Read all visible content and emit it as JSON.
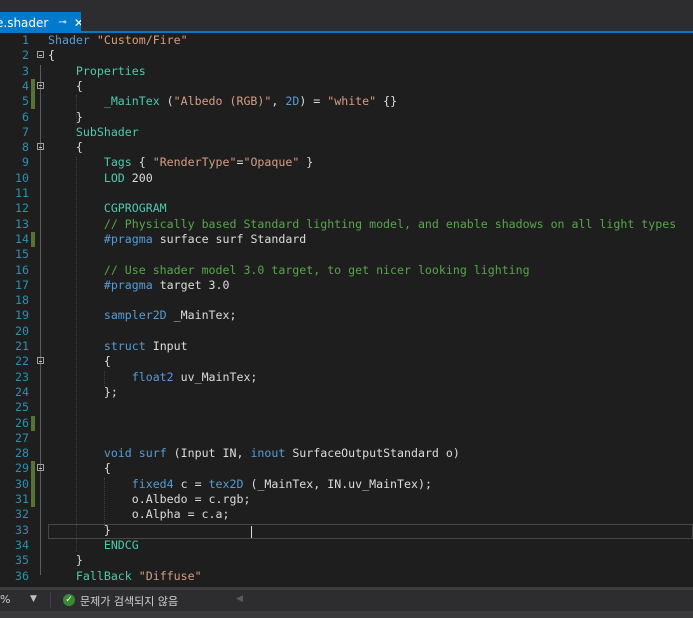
{
  "tab": {
    "title": "e.shader",
    "pin_icon": "pin-icon",
    "close_icon": "close-icon"
  },
  "editor": {
    "lines": [
      {
        "n": "1",
        "tokens": [
          [
            "kw",
            "Shader"
          ],
          [
            "tx",
            " "
          ],
          [
            "st",
            "\"Custom/Fire\""
          ]
        ]
      },
      {
        "n": "2",
        "tokens": [
          [
            "tx",
            "{"
          ]
        ]
      },
      {
        "n": "3",
        "tokens": [
          [
            "tx",
            "    "
          ],
          [
            "pr",
            "Properties"
          ]
        ]
      },
      {
        "n": "4",
        "tokens": [
          [
            "tx",
            "    {"
          ]
        ]
      },
      {
        "n": "5",
        "tokens": [
          [
            "tx",
            "        "
          ],
          [
            "pr",
            "_MainTex"
          ],
          [
            "tx",
            " ("
          ],
          [
            "st",
            "\"Albedo (RGB)\""
          ],
          [
            "tx",
            ", "
          ],
          [
            "kw",
            "2D"
          ],
          [
            "tx",
            ") = "
          ],
          [
            "st",
            "\"white\""
          ],
          [
            "tx",
            " {}"
          ]
        ]
      },
      {
        "n": "6",
        "tokens": [
          [
            "tx",
            "    }"
          ]
        ]
      },
      {
        "n": "7",
        "tokens": [
          [
            "tx",
            "    "
          ],
          [
            "pr",
            "SubShader"
          ]
        ]
      },
      {
        "n": "8",
        "tokens": [
          [
            "tx",
            "    {"
          ]
        ]
      },
      {
        "n": "9",
        "tokens": [
          [
            "tx",
            "        "
          ],
          [
            "pr",
            "Tags"
          ],
          [
            "tx",
            " { "
          ],
          [
            "st",
            "\"RenderType\""
          ],
          [
            "tx",
            "="
          ],
          [
            "st",
            "\"Opaque\""
          ],
          [
            "tx",
            " }"
          ]
        ]
      },
      {
        "n": "10",
        "tokens": [
          [
            "tx",
            "        "
          ],
          [
            "pr",
            "LOD"
          ],
          [
            "tx",
            " 200"
          ]
        ]
      },
      {
        "n": "11",
        "tokens": []
      },
      {
        "n": "12",
        "tokens": [
          [
            "tx",
            "        "
          ],
          [
            "pr",
            "CGPROGRAM"
          ]
        ]
      },
      {
        "n": "13",
        "tokens": [
          [
            "tx",
            "        "
          ],
          [
            "cm",
            "// Physically based Standard lighting model, and enable shadows on all light types"
          ]
        ]
      },
      {
        "n": "14",
        "tokens": [
          [
            "tx",
            "        "
          ],
          [
            "kw",
            "#pragma"
          ],
          [
            "tx",
            " surface surf Standard"
          ]
        ]
      },
      {
        "n": "15",
        "tokens": []
      },
      {
        "n": "16",
        "tokens": [
          [
            "tx",
            "        "
          ],
          [
            "cm",
            "// Use shader model 3.0 target, to get nicer looking lighting"
          ]
        ]
      },
      {
        "n": "17",
        "tokens": [
          [
            "tx",
            "        "
          ],
          [
            "kw",
            "#pragma"
          ],
          [
            "tx",
            " target 3.0"
          ]
        ]
      },
      {
        "n": "18",
        "tokens": []
      },
      {
        "n": "19",
        "tokens": [
          [
            "tx",
            "        "
          ],
          [
            "kw",
            "sampler2D"
          ],
          [
            "tx",
            " _MainTex;"
          ]
        ]
      },
      {
        "n": "20",
        "tokens": []
      },
      {
        "n": "21",
        "tokens": [
          [
            "tx",
            "        "
          ],
          [
            "kw",
            "struct"
          ],
          [
            "tx",
            " Input"
          ]
        ]
      },
      {
        "n": "22",
        "tokens": [
          [
            "tx",
            "        {"
          ]
        ]
      },
      {
        "n": "23",
        "tokens": [
          [
            "tx",
            "            "
          ],
          [
            "kw",
            "float2"
          ],
          [
            "tx",
            " uv_MainTex;"
          ]
        ]
      },
      {
        "n": "24",
        "tokens": [
          [
            "tx",
            "        };"
          ]
        ]
      },
      {
        "n": "25",
        "tokens": []
      },
      {
        "n": "26",
        "tokens": []
      },
      {
        "n": "27",
        "tokens": []
      },
      {
        "n": "28",
        "tokens": [
          [
            "tx",
            "        "
          ],
          [
            "kw",
            "void"
          ],
          [
            "tx",
            " "
          ],
          [
            "kw",
            "surf"
          ],
          [
            "tx",
            " (Input IN, "
          ],
          [
            "kw",
            "inout"
          ],
          [
            "tx",
            " SurfaceOutputStandard o)"
          ]
        ]
      },
      {
        "n": "29",
        "tokens": [
          [
            "tx",
            "        {"
          ]
        ]
      },
      {
        "n": "30",
        "tokens": [
          [
            "tx",
            "            "
          ],
          [
            "kw",
            "fixed4"
          ],
          [
            "tx",
            " c = "
          ],
          [
            "kw",
            "tex2D"
          ],
          [
            "tx",
            " (_MainTex, IN.uv_MainTex);"
          ]
        ]
      },
      {
        "n": "31",
        "tokens": [
          [
            "tx",
            "            o.Albedo = c.rgb;"
          ]
        ]
      },
      {
        "n": "32",
        "tokens": [
          [
            "tx",
            "            o.Alpha = c.a;"
          ]
        ]
      },
      {
        "n": "33",
        "tokens": [
          [
            "tx",
            "        }"
          ]
        ]
      },
      {
        "n": "34",
        "tokens": [
          [
            "tx",
            "        "
          ],
          [
            "pr",
            "ENDCG"
          ]
        ]
      },
      {
        "n": "35",
        "tokens": [
          [
            "tx",
            "    }"
          ]
        ]
      },
      {
        "n": "36",
        "tokens": [
          [
            "tx",
            "    "
          ],
          [
            "pr",
            "FallBack"
          ],
          [
            "tx",
            " "
          ],
          [
            "st",
            "\"Diffuse\""
          ]
        ]
      }
    ],
    "fold_lines": [
      "2",
      "4",
      "8",
      "22",
      "29"
    ],
    "changed_lines": [
      "4",
      "5",
      "14",
      "26",
      "29",
      "30",
      "31"
    ],
    "current_line": "31"
  },
  "status": {
    "zoom": "%",
    "issues_text": "문제가 검색되지 않음",
    "ok_icon": "check-circle-icon"
  },
  "colors": {
    "accent": "#007acc",
    "keyword": "#569cd6",
    "string": "#d69d85",
    "comment": "#57a64a",
    "line_number": "#2b91af",
    "change_marker": "#577430"
  }
}
